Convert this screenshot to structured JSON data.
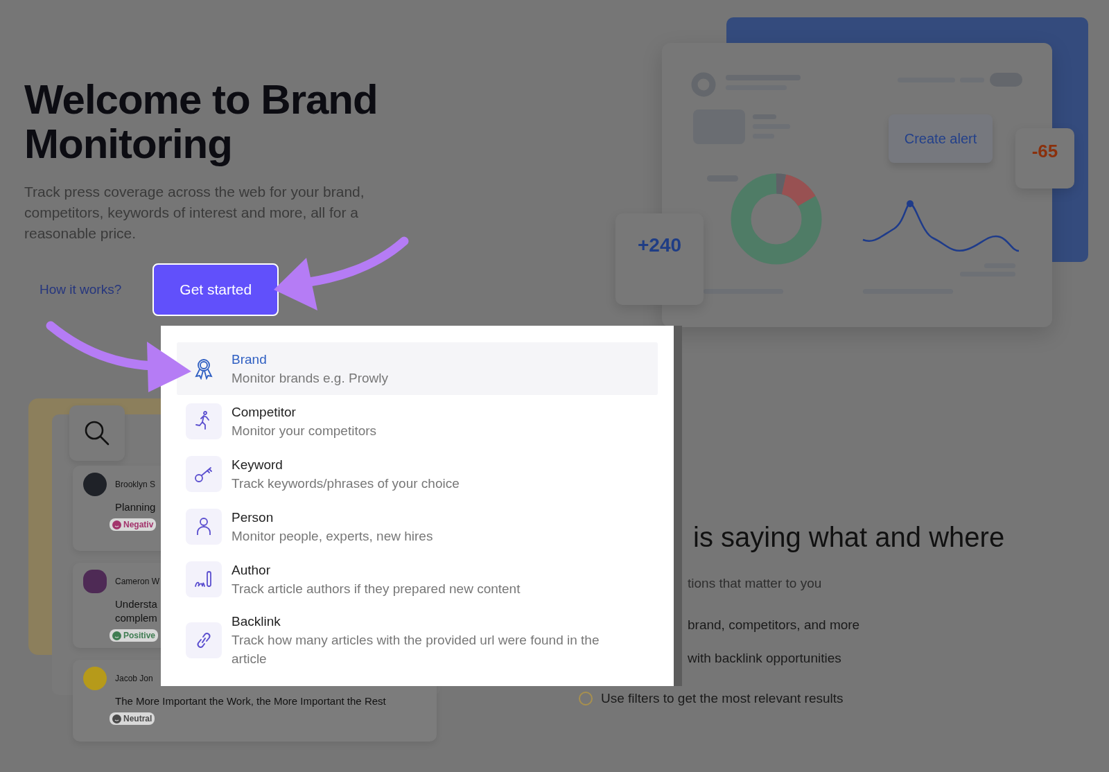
{
  "hero": {
    "title": "Welcome to Brand Monitoring",
    "subtitle": "Track press coverage across the web for your brand, competitors, keywords of interest and more, all for a reasonable price.",
    "link": "How it works?",
    "button": "Get started"
  },
  "illustration": {
    "create_alert": "Create alert",
    "score_negative": "-65",
    "score_positive": "+240"
  },
  "dropdown": {
    "items": [
      {
        "title": "Brand",
        "description": "Monitor brands e.g. Prowly",
        "selected": true
      },
      {
        "title": "Competitor",
        "description": "Monitor your competitors",
        "selected": false
      },
      {
        "title": "Keyword",
        "description": "Track keywords/phrases of your choice",
        "selected": false
      },
      {
        "title": "Person",
        "description": "Monitor people, experts, new hires",
        "selected": false
      },
      {
        "title": "Author",
        "description": "Track article authors if they prepared new content",
        "selected": false
      },
      {
        "title": "Backlink",
        "description": "Track how many articles with the provided url were found in the article",
        "selected": false
      }
    ]
  },
  "news_cards": [
    {
      "author": "Brooklyn S",
      "title": "Planning",
      "sentiment": "Negativ",
      "color": "#a3336c"
    },
    {
      "author": "Cameron W",
      "title": "Understa\ncomplem",
      "sentiment": "Positive",
      "color": "#3f7d52"
    },
    {
      "author": "Jacob Jon",
      "title": "The More Important the Work, the More Important the Rest",
      "sentiment": "Neutral",
      "color": "#4a4a4a"
    }
  ],
  "features": {
    "heading": "is saying what and where",
    "subtitle": "tions that matter to you",
    "items": [
      {
        "text": "brand, competitors, and more",
        "kind": "cut"
      },
      {
        "text": "with backlink opportunities",
        "kind": "cut"
      },
      {
        "text": "Use filters to get the most relevant results",
        "kind": "full"
      }
    ]
  }
}
